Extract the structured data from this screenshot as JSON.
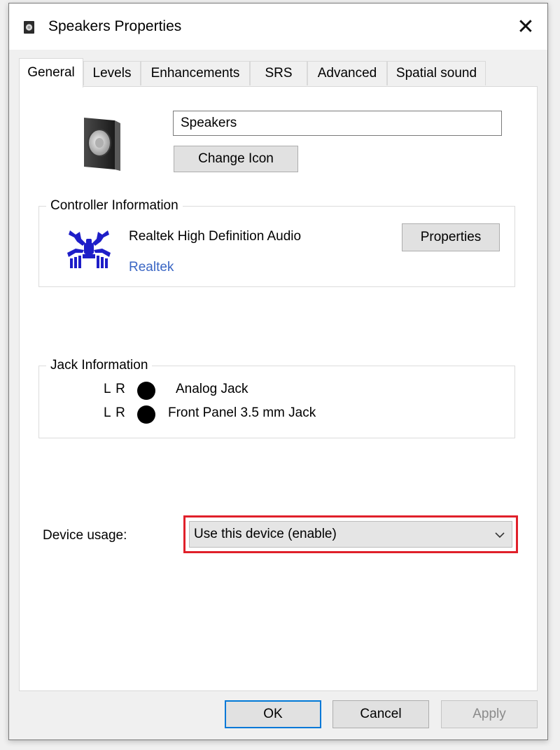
{
  "window": {
    "title": "Speakers Properties",
    "close_glyph": "✕"
  },
  "tabs": [
    {
      "label": "General",
      "active": true
    },
    {
      "label": "Levels"
    },
    {
      "label": "Enhancements"
    },
    {
      "label": "SRS"
    },
    {
      "label": "Advanced"
    },
    {
      "label": "Spatial sound"
    }
  ],
  "general": {
    "device_name": "Speakers",
    "change_icon_label": "Change Icon",
    "icon": "speaker-icon"
  },
  "controller": {
    "title": "Controller Information",
    "name": "Realtek High Definition Audio",
    "vendor_link": "Realtek",
    "properties_label": "Properties",
    "logo": "realtek-crab-logo",
    "link_color": "#3a66c4"
  },
  "jack": {
    "title": "Jack Information",
    "rows": [
      {
        "channels": "L R",
        "label": "Analog Jack"
      },
      {
        "channels": "L R",
        "label": "Front Panel 3.5 mm Jack"
      }
    ]
  },
  "usage": {
    "label": "Device usage:",
    "selected": "Use this device (enable)",
    "highlight_color": "#e0202a"
  },
  "footer": {
    "ok_label": "OK",
    "cancel_label": "Cancel",
    "apply_label": "Apply"
  },
  "colors": {
    "accent": "#0078d7"
  }
}
